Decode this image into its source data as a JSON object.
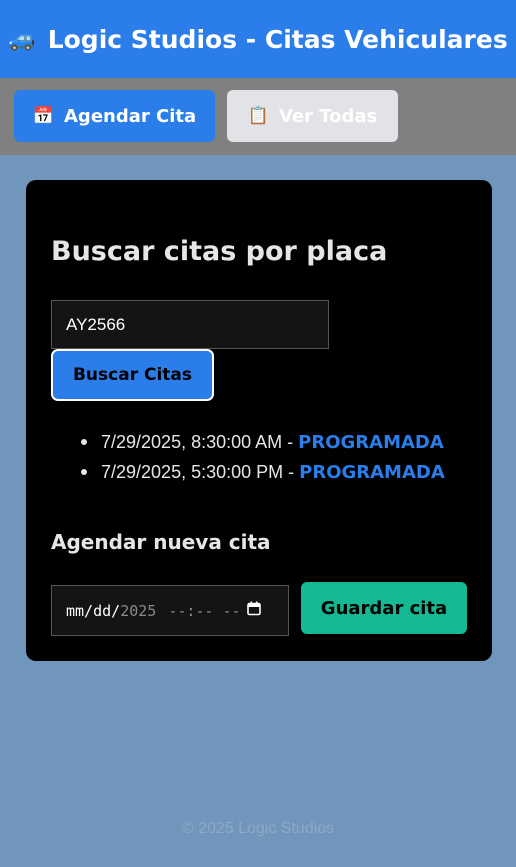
{
  "header": {
    "icon": "car-icon",
    "icon_glyph": "🚙",
    "title": "Logic Studios - Citas Vehiculares"
  },
  "nav": {
    "agendar": {
      "icon": "calendar-icon",
      "icon_glyph": "📅",
      "label": "Agendar Cita"
    },
    "ver": {
      "icon": "clipboard-icon",
      "icon_glyph": "📋",
      "label": "Ver Todas"
    }
  },
  "search": {
    "heading": "Buscar citas por placa",
    "plate_value": "AY2566",
    "button_label": "Buscar Citas",
    "results": [
      {
        "datetime": "7/29/2025, 8:30:00 AM",
        "separator": " - ",
        "status": "PROGRAMADA"
      },
      {
        "datetime": "7/29/2025, 5:30:00 PM",
        "separator": " - ",
        "status": "PROGRAMADA"
      }
    ]
  },
  "schedule": {
    "heading": "Agendar nueva cita",
    "date_mmdd": "mm/dd/",
    "date_year": "2025",
    "time_placeholder": "--:-- --",
    "calendar_icon": "calendar-picker-icon",
    "button_label": "Guardar cita"
  },
  "footer": {
    "text": "© 2025 Logic Studios"
  },
  "colors": {
    "primary": "#2b7de9",
    "success": "#14b892",
    "background": "#7096bb",
    "card": "#000000"
  }
}
